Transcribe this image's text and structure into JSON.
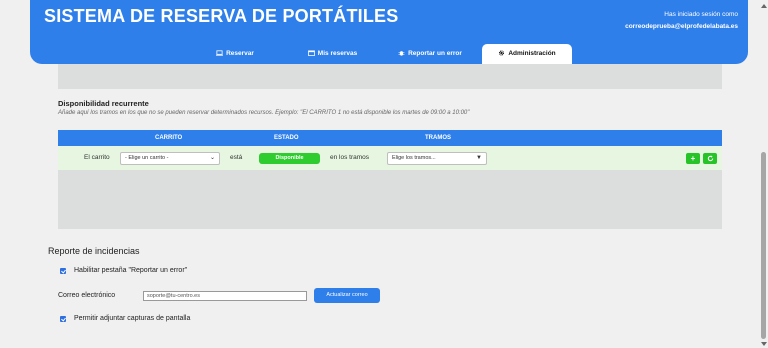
{
  "header": {
    "title": "SISTEMA DE RESERVA DE PORTÁTILES",
    "session_label": "Has iniciado sesión como",
    "session_email": "correodeprueba@elprofedelabata.es"
  },
  "tabs": [
    {
      "label": "Reservar",
      "icon": "laptop-icon"
    },
    {
      "label": "Mis reservas",
      "icon": "calendar-icon"
    },
    {
      "label": "Reportar un error",
      "icon": "bug-icon"
    },
    {
      "label": "Administración",
      "icon": "gear-icon",
      "active": true
    }
  ],
  "availability": {
    "title": "Disponibilidad recurrente",
    "description": "Añade aquí los tramos en los que no se pueden reservar determinados recursos. Ejemplo: \"El CARRITO 1 no está disponible los martes de 09:00 a 10:00\"",
    "columns": [
      "CARRITO",
      "ESTADO",
      "TRAMOS"
    ],
    "row": {
      "prefix": "El carrito",
      "cart_select": "- Elige un carrito -",
      "is_label": "está",
      "status": "Disponible",
      "in_label": "en los tramos",
      "slots_select": "Elige los tramos..."
    }
  },
  "incidents": {
    "title": "Reporte de incidencias",
    "enable_tab_label": "Habilitar pestaña \"Reportar un error\"",
    "email_label": "Correo electrónico",
    "email_value": "soporte@tu-centro.es",
    "update_button": "Actualizar correo",
    "screenshots_label": "Permitir adjuntar capturas de pantalla"
  },
  "colors": {
    "primary": "#2f7fea",
    "success": "#2ecc2e",
    "row_bg": "#e6f6e1",
    "panel_gray": "#dcdedd"
  }
}
